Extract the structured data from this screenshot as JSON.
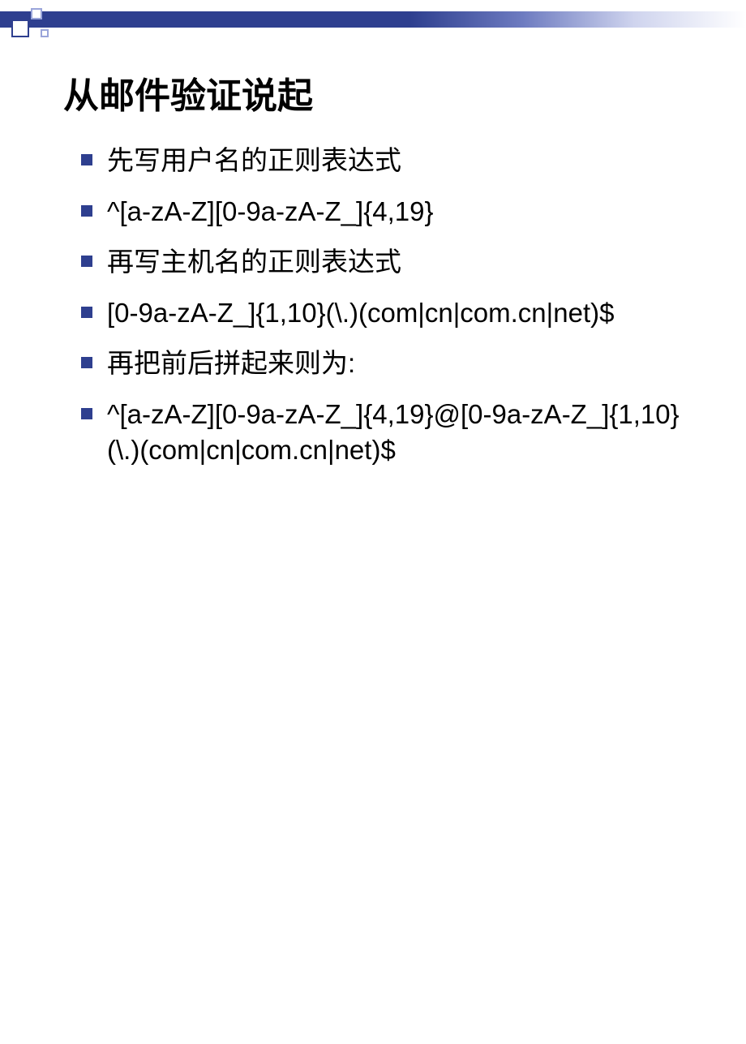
{
  "title": "从邮件验证说起",
  "items": [
    "先写用户名的正则表达式",
    "^[a-zA-Z][0-9a-zA-Z_]{4,19}",
    "再写主机名的正则表达式",
    "[0-9a-zA-Z_]{1,10}(\\.)(com|cn|com.cn|net)$",
    "再把前后拼起来则为:",
    "^[a-zA-Z][0-9a-zA-Z_]{4,19}@[0-9a-zA-Z_]{1,10}(\\.)(com|cn|com.cn|net)$"
  ]
}
